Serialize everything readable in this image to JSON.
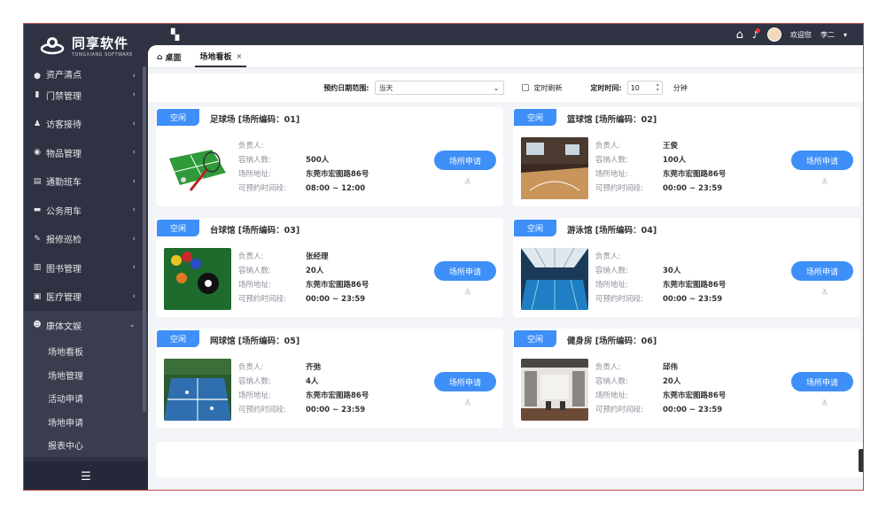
{
  "app": {
    "logo_title": "同享软件",
    "logo_sub": "TONGXIANG SOFTWARE"
  },
  "topbar": {
    "greeting": "欢迎您",
    "user": "李二",
    "grid_icon": "grid-icon",
    "home_icon": "home-icon",
    "bell_icon": "bell-icon"
  },
  "sidebar": {
    "items": [
      {
        "label": "资产清点",
        "icon": "asset-icon",
        "partial": true
      },
      {
        "label": "门禁管理",
        "icon": "door-icon"
      },
      {
        "label": "访客接待",
        "icon": "visitor-icon"
      },
      {
        "label": "物品管理",
        "icon": "box-icon"
      },
      {
        "label": "通勤班车",
        "icon": "bus-icon"
      },
      {
        "label": "公务用车",
        "icon": "car-icon"
      },
      {
        "label": "报修巡检",
        "icon": "wrench-icon"
      },
      {
        "label": "图书管理",
        "icon": "book-icon"
      },
      {
        "label": "医疗管理",
        "icon": "medical-icon"
      },
      {
        "label": "康体文娱",
        "icon": "leisure-icon",
        "open": true
      }
    ],
    "subitems": [
      "场地看板",
      "场地管理",
      "活动申请",
      "场地申请",
      "报表中心"
    ]
  },
  "tabs": [
    {
      "label": "桌面",
      "icon": "home-icon"
    },
    {
      "label": "场地看板",
      "active": true
    }
  ],
  "filter": {
    "range_label": "预约日期范围:",
    "range_value": "当天",
    "refresh_label": "定时刷新",
    "timer_label": "定时时间:",
    "timer_value": "10",
    "unit": "分钟"
  },
  "labels": {
    "manager": "负责人:",
    "capacity": "容纳人数:",
    "address": "场所地址:",
    "time": "可预约时间段:",
    "apply": "场所申请"
  },
  "venues": [
    {
      "status": "空闲",
      "title": "足球场 [场所编码：01]",
      "manager": "",
      "capacity": "500人",
      "address": "东莞市宏图路86号",
      "time": "08:00 ~ 12:00"
    },
    {
      "status": "空闲",
      "title": "篮球馆 [场所编码：02]",
      "manager": "王俊",
      "capacity": "100人",
      "address": "东莞市宏图路86号",
      "time": "00:00 ~ 23:59"
    },
    {
      "status": "空闲",
      "title": "台球馆 [场所编码：03]",
      "manager": "张经理",
      "capacity": "20人",
      "address": "东莞市宏图路86号",
      "time": "00:00 ~ 23:59"
    },
    {
      "status": "空闲",
      "title": "游泳馆 [场所编码：04]",
      "manager": "",
      "capacity": "30人",
      "address": "东莞市宏图路86号",
      "time": "00:00 ~ 23:59"
    },
    {
      "status": "空闲",
      "title": "网球馆 [场所编码：05]",
      "manager": "齐弛",
      "capacity": "4人",
      "address": "东莞市宏图路86号",
      "time": "00:00 ~ 23:59"
    },
    {
      "status": "空闲",
      "title": "健身房 [场所编码：06]",
      "manager": "邱伟",
      "capacity": "20人",
      "address": "东莞市宏图路86号",
      "time": "00:00 ~ 23:59"
    }
  ],
  "colors": {
    "accent": "#3e8ff7",
    "sidebar": "#2f3242"
  }
}
